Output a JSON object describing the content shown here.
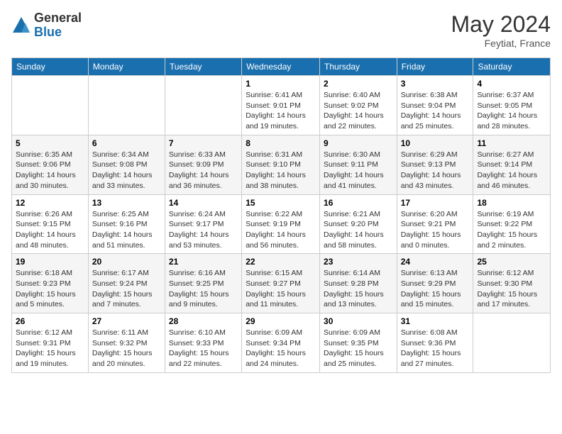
{
  "header": {
    "logo_general": "General",
    "logo_blue": "Blue",
    "month_year": "May 2024",
    "location": "Feytiat, France"
  },
  "days_of_week": [
    "Sunday",
    "Monday",
    "Tuesday",
    "Wednesday",
    "Thursday",
    "Friday",
    "Saturday"
  ],
  "weeks": [
    {
      "days": [
        {
          "num": "",
          "info": ""
        },
        {
          "num": "",
          "info": ""
        },
        {
          "num": "",
          "info": ""
        },
        {
          "num": "1",
          "info": "Sunrise: 6:41 AM\nSunset: 9:01 PM\nDaylight: 14 hours and 19 minutes."
        },
        {
          "num": "2",
          "info": "Sunrise: 6:40 AM\nSunset: 9:02 PM\nDaylight: 14 hours and 22 minutes."
        },
        {
          "num": "3",
          "info": "Sunrise: 6:38 AM\nSunset: 9:04 PM\nDaylight: 14 hours and 25 minutes."
        },
        {
          "num": "4",
          "info": "Sunrise: 6:37 AM\nSunset: 9:05 PM\nDaylight: 14 hours and 28 minutes."
        }
      ]
    },
    {
      "days": [
        {
          "num": "5",
          "info": "Sunrise: 6:35 AM\nSunset: 9:06 PM\nDaylight: 14 hours and 30 minutes."
        },
        {
          "num": "6",
          "info": "Sunrise: 6:34 AM\nSunset: 9:08 PM\nDaylight: 14 hours and 33 minutes."
        },
        {
          "num": "7",
          "info": "Sunrise: 6:33 AM\nSunset: 9:09 PM\nDaylight: 14 hours and 36 minutes."
        },
        {
          "num": "8",
          "info": "Sunrise: 6:31 AM\nSunset: 9:10 PM\nDaylight: 14 hours and 38 minutes."
        },
        {
          "num": "9",
          "info": "Sunrise: 6:30 AM\nSunset: 9:11 PM\nDaylight: 14 hours and 41 minutes."
        },
        {
          "num": "10",
          "info": "Sunrise: 6:29 AM\nSunset: 9:13 PM\nDaylight: 14 hours and 43 minutes."
        },
        {
          "num": "11",
          "info": "Sunrise: 6:27 AM\nSunset: 9:14 PM\nDaylight: 14 hours and 46 minutes."
        }
      ]
    },
    {
      "days": [
        {
          "num": "12",
          "info": "Sunrise: 6:26 AM\nSunset: 9:15 PM\nDaylight: 14 hours and 48 minutes."
        },
        {
          "num": "13",
          "info": "Sunrise: 6:25 AM\nSunset: 9:16 PM\nDaylight: 14 hours and 51 minutes."
        },
        {
          "num": "14",
          "info": "Sunrise: 6:24 AM\nSunset: 9:17 PM\nDaylight: 14 hours and 53 minutes."
        },
        {
          "num": "15",
          "info": "Sunrise: 6:22 AM\nSunset: 9:19 PM\nDaylight: 14 hours and 56 minutes."
        },
        {
          "num": "16",
          "info": "Sunrise: 6:21 AM\nSunset: 9:20 PM\nDaylight: 14 hours and 58 minutes."
        },
        {
          "num": "17",
          "info": "Sunrise: 6:20 AM\nSunset: 9:21 PM\nDaylight: 15 hours and 0 minutes."
        },
        {
          "num": "18",
          "info": "Sunrise: 6:19 AM\nSunset: 9:22 PM\nDaylight: 15 hours and 2 minutes."
        }
      ]
    },
    {
      "days": [
        {
          "num": "19",
          "info": "Sunrise: 6:18 AM\nSunset: 9:23 PM\nDaylight: 15 hours and 5 minutes."
        },
        {
          "num": "20",
          "info": "Sunrise: 6:17 AM\nSunset: 9:24 PM\nDaylight: 15 hours and 7 minutes."
        },
        {
          "num": "21",
          "info": "Sunrise: 6:16 AM\nSunset: 9:25 PM\nDaylight: 15 hours and 9 minutes."
        },
        {
          "num": "22",
          "info": "Sunrise: 6:15 AM\nSunset: 9:27 PM\nDaylight: 15 hours and 11 minutes."
        },
        {
          "num": "23",
          "info": "Sunrise: 6:14 AM\nSunset: 9:28 PM\nDaylight: 15 hours and 13 minutes."
        },
        {
          "num": "24",
          "info": "Sunrise: 6:13 AM\nSunset: 9:29 PM\nDaylight: 15 hours and 15 minutes."
        },
        {
          "num": "25",
          "info": "Sunrise: 6:12 AM\nSunset: 9:30 PM\nDaylight: 15 hours and 17 minutes."
        }
      ]
    },
    {
      "days": [
        {
          "num": "26",
          "info": "Sunrise: 6:12 AM\nSunset: 9:31 PM\nDaylight: 15 hours and 19 minutes."
        },
        {
          "num": "27",
          "info": "Sunrise: 6:11 AM\nSunset: 9:32 PM\nDaylight: 15 hours and 20 minutes."
        },
        {
          "num": "28",
          "info": "Sunrise: 6:10 AM\nSunset: 9:33 PM\nDaylight: 15 hours and 22 minutes."
        },
        {
          "num": "29",
          "info": "Sunrise: 6:09 AM\nSunset: 9:34 PM\nDaylight: 15 hours and 24 minutes."
        },
        {
          "num": "30",
          "info": "Sunrise: 6:09 AM\nSunset: 9:35 PM\nDaylight: 15 hours and 25 minutes."
        },
        {
          "num": "31",
          "info": "Sunrise: 6:08 AM\nSunset: 9:36 PM\nDaylight: 15 hours and 27 minutes."
        },
        {
          "num": "",
          "info": ""
        }
      ]
    }
  ]
}
